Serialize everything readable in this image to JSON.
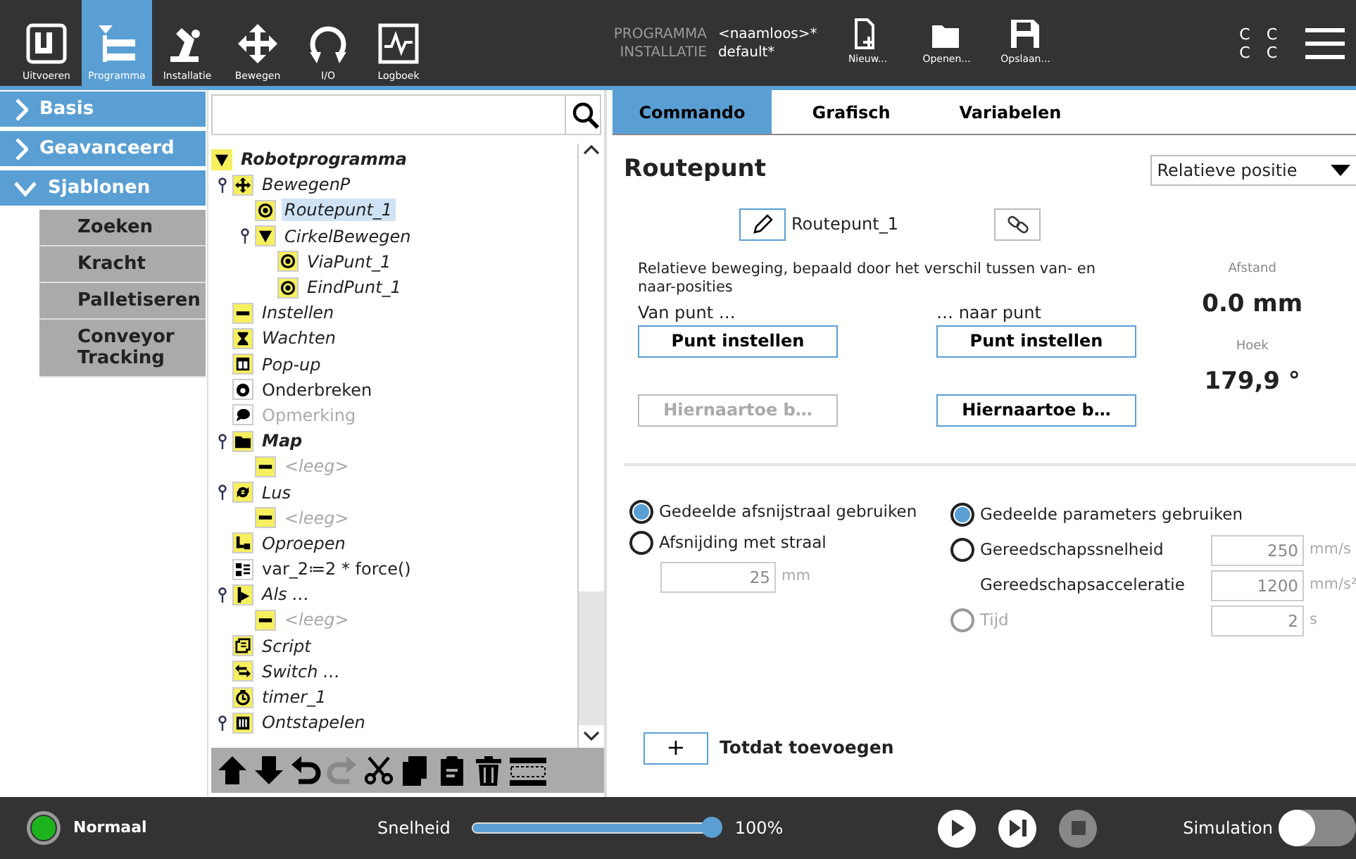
{
  "top_bar": {
    "nav_tabs": [
      {
        "label": "Uitvoeren",
        "kind": "run",
        "selected": false
      },
      {
        "label": "Programma",
        "kind": "program",
        "selected": true
      },
      {
        "label": "Installatie",
        "kind": "install",
        "selected": false
      },
      {
        "label": "Bewegen",
        "kind": "move",
        "selected": false
      },
      {
        "label": "I/O",
        "kind": "io",
        "selected": false
      },
      {
        "label": "Logboek",
        "kind": "log",
        "selected": false
      }
    ],
    "program_label": "PROGRAMMA",
    "program_name": "<naamloos>*",
    "installation_label": "INSTALLATIE",
    "installation_name": "default*",
    "file_buttons": [
      {
        "label": "Nieuw...",
        "kind": "new"
      },
      {
        "label": "Openen...",
        "kind": "open"
      },
      {
        "label": "Opslaan...",
        "kind": "save"
      }
    ],
    "indicators": [
      "C",
      "C",
      "C",
      "C"
    ]
  },
  "sidebar": [
    {
      "label": "Basis",
      "expanded": false
    },
    {
      "label": "Geavanceerd",
      "expanded": false
    },
    {
      "label": "Sjablonen",
      "expanded": true,
      "children": [
        "Zoeken",
        "Kracht",
        "Palletiseren",
        "Conveyor Tracking"
      ]
    }
  ],
  "tree": {
    "label": "Robotprogramma",
    "kind": "triangle",
    "bold": true,
    "italic": true,
    "dimmed": false,
    "selected": false,
    "children": [
      {
        "label": "BewegenP",
        "kind": "move",
        "bold": false,
        "italic": true,
        "dimmed": false,
        "selected": false,
        "children": [
          {
            "label": "Routepunt_1",
            "kind": "waypoint",
            "bold": false,
            "italic": true,
            "dimmed": false,
            "selected": true
          },
          {
            "label": "CirkelBewegen",
            "kind": "triangle",
            "bold": false,
            "italic": true,
            "dimmed": false,
            "selected": false,
            "children": [
              {
                "label": "ViaPunt_1",
                "kind": "waypoint",
                "bold": false,
                "italic": true,
                "dimmed": false,
                "selected": false
              },
              {
                "label": "EindPunt_1",
                "kind": "waypoint",
                "bold": false,
                "italic": true,
                "dimmed": false,
                "selected": false
              }
            ]
          }
        ]
      },
      {
        "label": "Instellen",
        "kind": "set",
        "bold": false,
        "italic": true,
        "dimmed": false,
        "selected": false
      },
      {
        "label": "Wachten",
        "kind": "wait",
        "bold": false,
        "italic": true,
        "dimmed": false,
        "selected": false
      },
      {
        "label": "Pop-up",
        "kind": "popup",
        "bold": false,
        "italic": true,
        "dimmed": false,
        "selected": false
      },
      {
        "label": "Onderbreken",
        "kind": "halt",
        "bold": false,
        "italic": false,
        "dimmed": false,
        "selected": false
      },
      {
        "label": "Opmerking",
        "kind": "comment",
        "bold": false,
        "italic": false,
        "dimmed": true,
        "selected": false
      },
      {
        "label": "Map",
        "kind": "folder",
        "bold": true,
        "italic": true,
        "dimmed": false,
        "selected": false,
        "children": [
          {
            "label": "<leeg>",
            "kind": "set",
            "bold": false,
            "italic": true,
            "dimmed": true,
            "selected": false
          }
        ]
      },
      {
        "label": "Lus",
        "kind": "loop",
        "bold": false,
        "italic": true,
        "dimmed": false,
        "selected": false,
        "children": [
          {
            "label": "<leeg>",
            "kind": "set",
            "bold": false,
            "italic": true,
            "dimmed": true,
            "selected": false
          }
        ]
      },
      {
        "label": "Oproepen",
        "kind": "call",
        "bold": false,
        "italic": true,
        "dimmed": false,
        "selected": false
      },
      {
        "label": "var_2≔2 * force()",
        "kind": "assign",
        "bold": false,
        "italic": false,
        "dimmed": false,
        "selected": false
      },
      {
        "label": "Als …",
        "kind": "if",
        "bold": false,
        "italic": true,
        "dimmed": false,
        "selected": false,
        "children": [
          {
            "label": "<leeg>",
            "kind": "set",
            "bold": false,
            "italic": true,
            "dimmed": true,
            "selected": false
          }
        ]
      },
      {
        "label": "Script",
        "kind": "script",
        "bold": false,
        "italic": true,
        "dimmed": false,
        "selected": false
      },
      {
        "label": "Switch …",
        "kind": "switch",
        "bold": false,
        "italic": true,
        "dimmed": false,
        "selected": false
      },
      {
        "label": "timer_1",
        "kind": "timer",
        "bold": false,
        "italic": true,
        "dimmed": false,
        "selected": false
      },
      {
        "label": "Ontstapelen",
        "kind": "unstack",
        "bold": false,
        "italic": true,
        "dimmed": false,
        "selected": false,
        "collapsible": true
      }
    ]
  },
  "tree_toolbar": [
    {
      "kind": "up",
      "disabled": false
    },
    {
      "kind": "down",
      "disabled": false
    },
    {
      "kind": "undo",
      "disabled": false
    },
    {
      "kind": "redo",
      "disabled": true
    },
    {
      "kind": "cut",
      "disabled": false
    },
    {
      "kind": "copy",
      "disabled": false
    },
    {
      "kind": "paste",
      "disabled": false
    },
    {
      "kind": "delete",
      "disabled": false
    },
    {
      "kind": "suppress",
      "disabled": false
    }
  ],
  "panel": {
    "tabs": [
      {
        "label": "Commando",
        "selected": true
      },
      {
        "label": "Grafisch",
        "selected": false
      },
      {
        "label": "Variabelen",
        "selected": false
      }
    ],
    "title": "Routepunt",
    "position_type": "Relatieve positie",
    "waypoint_name": "Routepunt_1",
    "description": "Relatieve beweging, bepaald door het verschil tussen van- en naar-posities",
    "points": [
      {
        "label": "Van punt …",
        "set_button": "Punt instellen",
        "move_button": "Hiernaartoe b…",
        "move_disabled": true
      },
      {
        "label": "… naar punt",
        "set_button": "Punt instellen",
        "move_button": "Hiernaartoe b…",
        "move_disabled": false
      }
    ],
    "readings": [
      {
        "label": "Afstand",
        "value": "0.0 mm"
      },
      {
        "label": "Hoek",
        "value": "179,9 °"
      }
    ],
    "blend": {
      "options": [
        {
          "label": "Gedeelde afsnijstraal gebruiken",
          "selected": true
        },
        {
          "label": "Afsnijding met straal",
          "selected": false
        }
      ],
      "radius": {
        "value": "25",
        "unit": "mm",
        "disabled": true
      }
    },
    "parameters": [
      {
        "kind": "radio",
        "label": "Gedeelde parameters gebruiken",
        "selected": true,
        "disabled": false
      },
      {
        "kind": "radio",
        "label": "Gereedschapssnelheid",
        "selected": false,
        "disabled": false,
        "value": "250",
        "unit": "mm/s"
      },
      {
        "kind": "plain",
        "label": "Gereedschapsacceleratie",
        "value": "1200",
        "unit": "mm/s²"
      },
      {
        "kind": "radio",
        "label": "Tijd",
        "selected": false,
        "disabled": true,
        "value": "2",
        "unit": "s"
      }
    ],
    "add_until": {
      "button": "+",
      "label": "Totdat toevoegen"
    }
  },
  "bottom_bar": {
    "status": "Normaal",
    "speed_label": "Snelheid",
    "speed": {
      "level": 1.0,
      "reading": "100%"
    },
    "controls": [
      {
        "kind": "play",
        "disabled": false
      },
      {
        "kind": "step",
        "disabled": false
      },
      {
        "kind": "stop",
        "disabled": true
      }
    ],
    "simulation": {
      "label": "Simulation",
      "on": false
    }
  }
}
